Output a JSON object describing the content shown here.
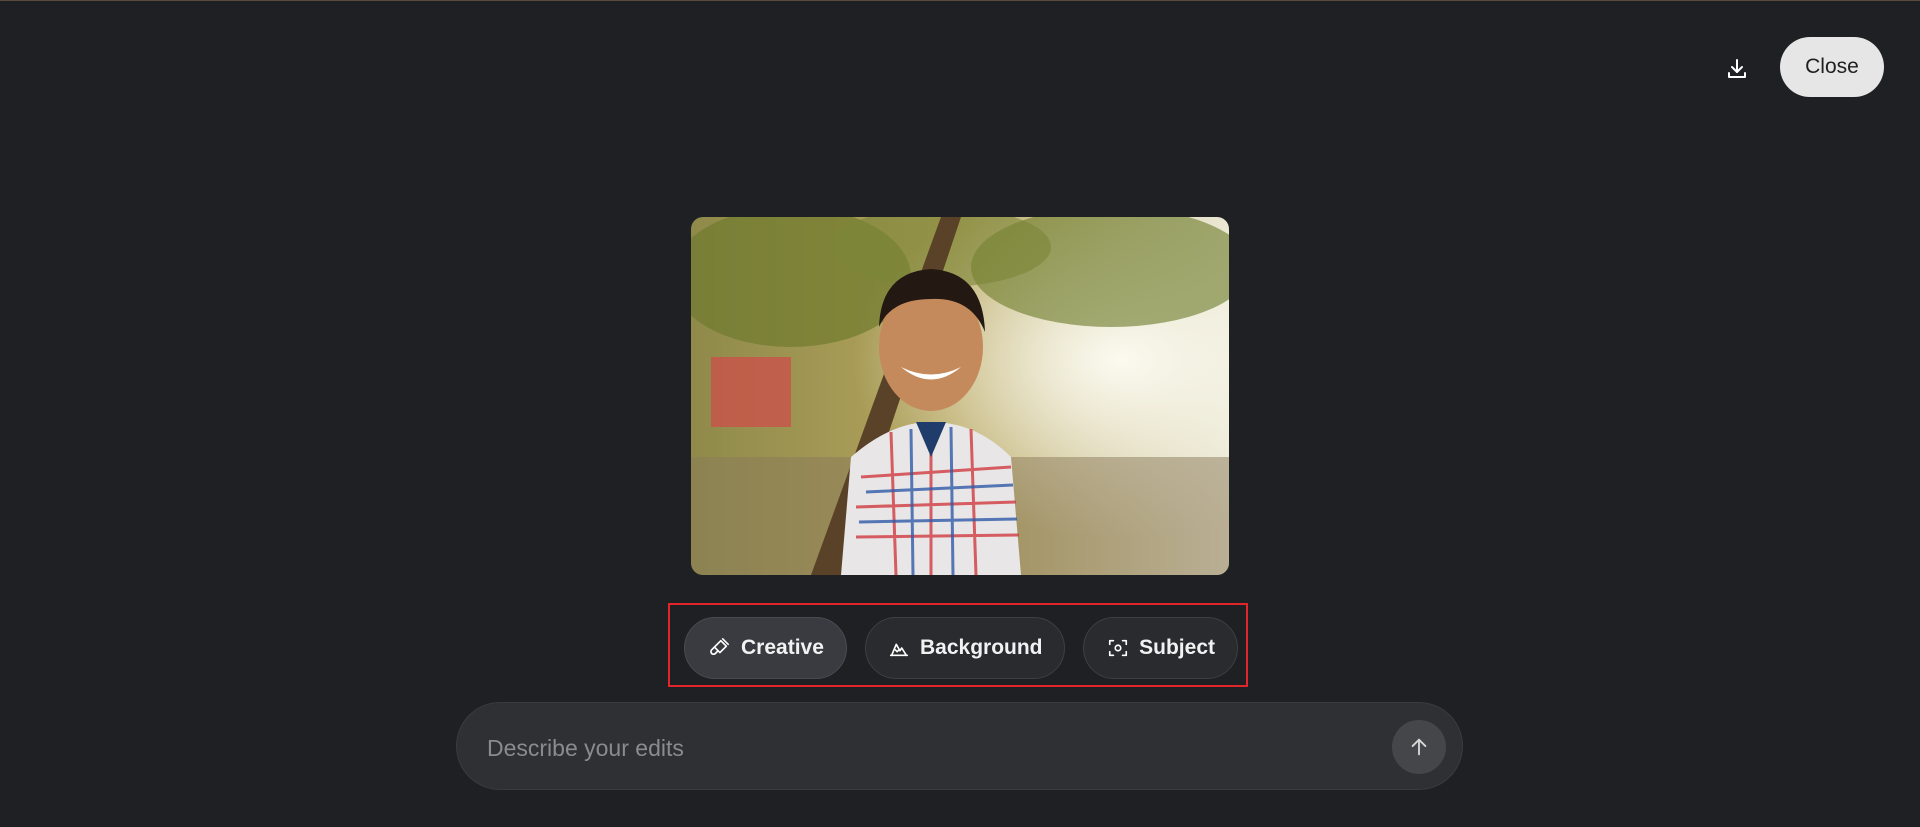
{
  "header": {
    "download_icon": "download-icon",
    "close_label": "Close"
  },
  "image": {
    "alt": "Smiling boy in plaid shirt outdoors under trees"
  },
  "edit_modes": [
    {
      "label": "Creative",
      "icon": "paintbrush-icon",
      "active": true
    },
    {
      "label": "Background",
      "icon": "mountain-icon",
      "active": false
    },
    {
      "label": "Subject",
      "icon": "focus-frame-icon",
      "active": false
    }
  ],
  "prompt": {
    "placeholder": "Describe your edits",
    "value": "",
    "send_icon": "arrow-up-icon"
  },
  "colors": {
    "background": "#1f2024",
    "highlight_border": "#e0262b",
    "close_button_bg": "#e6e6e6"
  }
}
